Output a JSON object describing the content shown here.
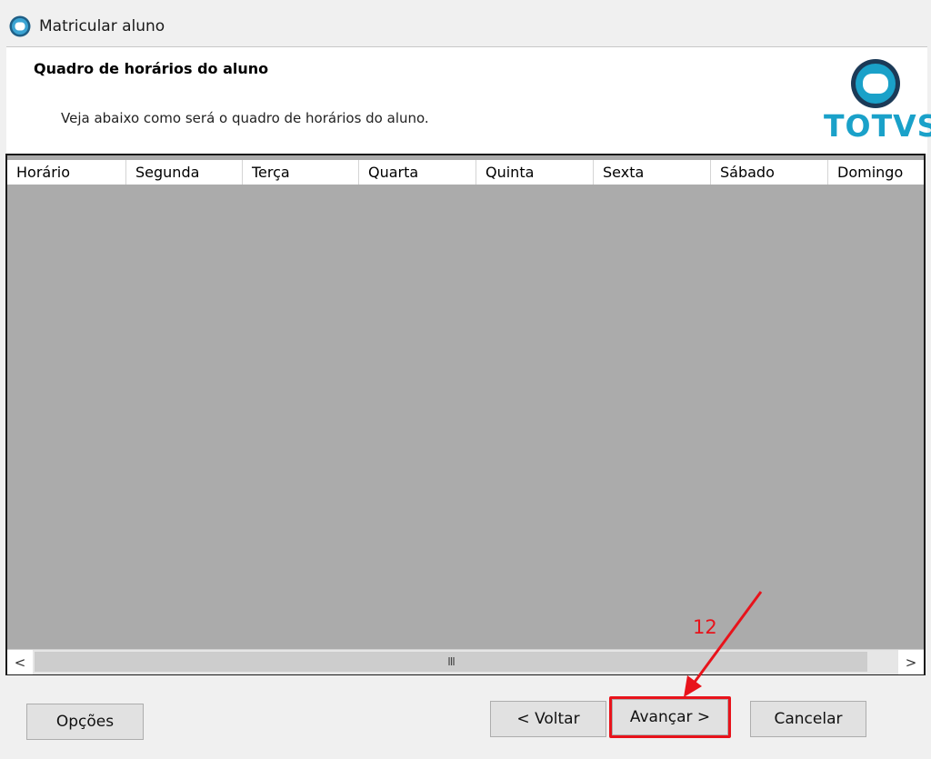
{
  "window": {
    "title": "Matricular aluno"
  },
  "header": {
    "heading": "Quadro de horários do aluno",
    "description": "Veja abaixo como será o quadro de horários do aluno.",
    "logo_text": "TOTVS"
  },
  "grid": {
    "columns": [
      "Horário",
      "Segunda",
      "Terça",
      "Quarta",
      "Quinta",
      "Sexta",
      "Sábado",
      "Domingo"
    ],
    "rows": [],
    "scroll_left_glyph": "<",
    "scroll_right_glyph": ">",
    "scroll_thumb_glyph": "III"
  },
  "footer": {
    "options_label": "Opções",
    "back_label": "< Voltar",
    "next_label": "Avançar >",
    "cancel_label": "Cancelar"
  },
  "annotation": {
    "step": "12",
    "color": "#e8131b"
  },
  "colors": {
    "brand": "#1aa1c9",
    "grid_background": "#ababab"
  },
  "icons": {
    "app": "totvs-logo-icon",
    "scroll_left": "chevron-left-icon",
    "scroll_right": "chevron-right-icon"
  }
}
